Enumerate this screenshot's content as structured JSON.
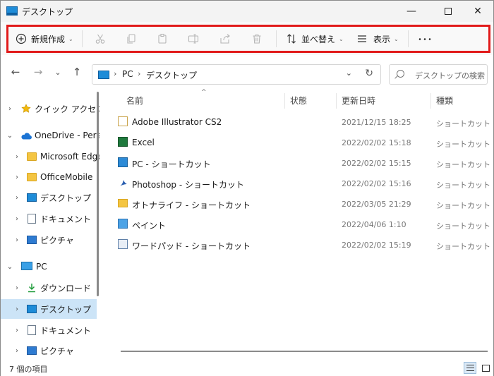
{
  "window": {
    "title": "デスクトップ"
  },
  "toolbar": {
    "new_label": "新規作成",
    "sort_label": "並べ替え",
    "view_label": "表示",
    "more_label": "･･･"
  },
  "address": {
    "crumbs": [
      "PC",
      "デスクトップ"
    ],
    "search_placeholder": "デスクトップの検索"
  },
  "nav": {
    "items": [
      {
        "label": "クイック アクセス",
        "icon": "star-icon"
      },
      {
        "label": "OneDrive - Perso",
        "icon": "cloud-icon"
      },
      {
        "label": "Microsoft Edge",
        "icon": "folder-icon"
      },
      {
        "label": "OfficeMobile",
        "icon": "folder-icon"
      },
      {
        "label": "デスクトップ",
        "icon": "desktop-icon"
      },
      {
        "label": "ドキュメント",
        "icon": "document-icon"
      },
      {
        "label": "ピクチャ",
        "icon": "picture-icon"
      },
      {
        "label": "PC",
        "icon": "pc-icon"
      },
      {
        "label": "ダウンロード",
        "icon": "download-icon"
      },
      {
        "label": "デスクトップ",
        "icon": "desktop-icon"
      },
      {
        "label": "ドキュメント",
        "icon": "document-icon"
      },
      {
        "label": "ピクチャ",
        "icon": "picture-icon"
      }
    ]
  },
  "columns": {
    "name": "名前",
    "status": "状態",
    "modified": "更新日時",
    "type": "種類"
  },
  "files": [
    {
      "name": "Adobe Illustrator CS2",
      "modified": "2021/12/15 18:25",
      "type": "ショートカット"
    },
    {
      "name": "Excel",
      "modified": "2022/02/02 15:18",
      "type": "ショートカット"
    },
    {
      "name": "PC - ショートカット",
      "modified": "2022/02/02 15:15",
      "type": "ショートカット"
    },
    {
      "name": "Photoshop - ショートカット",
      "modified": "2022/02/02 15:16",
      "type": "ショートカット"
    },
    {
      "name": "オトナライフ - ショートカット",
      "modified": "2022/03/05 21:29",
      "type": "ショートカット"
    },
    {
      "name": "ペイント",
      "modified": "2022/04/06 1:10",
      "type": "ショートカット"
    },
    {
      "name": "ワードパッド - ショートカット",
      "modified": "2022/02/02 15:19",
      "type": "ショートカット"
    }
  ],
  "status": {
    "count": "7 個の項目"
  },
  "colors": {
    "highlight": "#e11a1a",
    "selected_nav": "#cce4f7",
    "accent": "#1e8cd8"
  }
}
